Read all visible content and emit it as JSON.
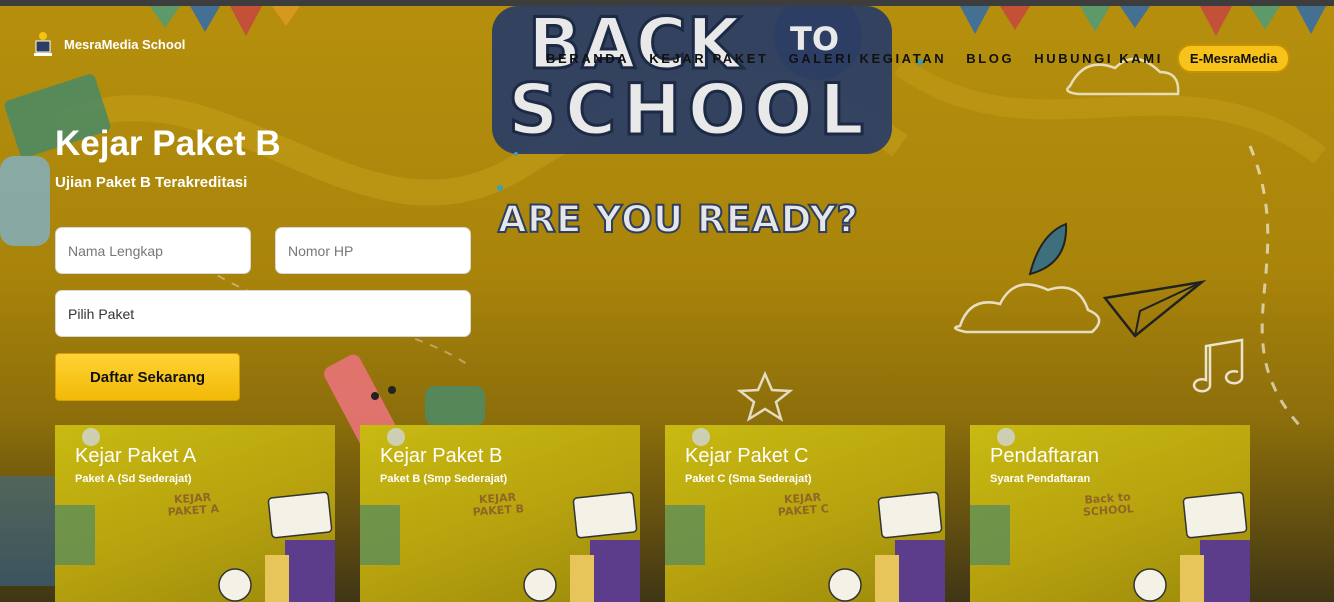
{
  "header": {
    "brand_name": "MesraMedia School",
    "nav": [
      "BERANDA",
      "KEJAR PAKET",
      "GALERI KEGIATAN",
      "BLOG",
      "HUBUNGI KAMI"
    ],
    "cta": "E-MesraMedia"
  },
  "banner": {
    "line1": "BACK",
    "line1b": "TO",
    "line2": "SCHOOL",
    "line3": "ARE YOU READY?"
  },
  "hero": {
    "title": "Kejar Paket B",
    "subtitle": "Ujian Paket B Terakreditasi"
  },
  "form": {
    "name_placeholder": "Nama Lengkap",
    "phone_placeholder": "Nomor HP",
    "package_select": "Pilih Paket",
    "submit_label": "Daftar Sekarang"
  },
  "cards": [
    {
      "title": "Kejar Paket A",
      "subtitle": "Paket A (Sd Sederajat)",
      "stamp": "KEJAR PAKET A"
    },
    {
      "title": "Kejar Paket B",
      "subtitle": "Paket B (Smp Sederajat)",
      "stamp": "KEJAR PAKET B"
    },
    {
      "title": "Kejar Paket C",
      "subtitle": "Paket C (Sma Sederajat)",
      "stamp": "KEJAR PAKET C"
    },
    {
      "title": "Pendaftaran",
      "subtitle": "Syarat Pendaftaran",
      "stamp": "Back to SCHOOL"
    }
  ],
  "colors": {
    "accent": "#f7c31a",
    "hero_bg": "#b58f0c",
    "banner_navy": "#2c3e63"
  }
}
